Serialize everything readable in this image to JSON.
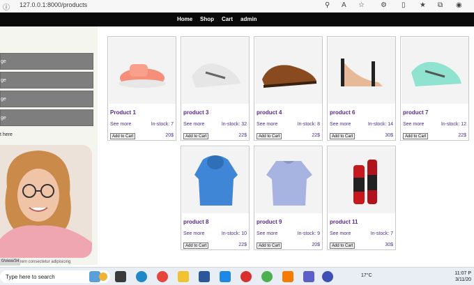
{
  "browser": {
    "url": "127.0.0.1:8000/products"
  },
  "nav": {
    "items": [
      "Home",
      "Shop",
      "Cart",
      "admin"
    ]
  },
  "sidebar": {
    "buttons": [
      "ge",
      "ge",
      "ge",
      "ge"
    ],
    "text": "t here",
    "footer": "Lorem consectetur adipisicing",
    "tooltip": "0/view/34"
  },
  "products": [
    {
      "name": "Product 1",
      "see": "See more",
      "stock": "In-stock: 7",
      "add": "Add to Cart",
      "price": "20$",
      "icon": "pink-baby-shoe-image"
    },
    {
      "name": "product 3",
      "see": "See more",
      "stock": "In-stock: 32",
      "add": "Add to Cart",
      "price": "22$",
      "icon": "white-golf-shoe-image"
    },
    {
      "name": "product 4",
      "see": "See more",
      "stock": "In-stock: 8",
      "add": "Add to Cart",
      "price": "22$",
      "icon": "brown-leather-shoe-image"
    },
    {
      "name": "product 6",
      "see": "See more",
      "stock": "In-stock: 14",
      "add": "Add to Cart",
      "price": "30$",
      "icon": "high-heel-image"
    },
    {
      "name": "product 7",
      "see": "See more",
      "stock": "In-stock: 12",
      "add": "Add to Cart",
      "price": "22$",
      "icon": "mint-golf-shoe-image"
    },
    {
      "name": "product 8",
      "see": "See more",
      "stock": "In-stock: 10",
      "add": "Add to Cart",
      "price": "22$",
      "icon": "blue-hoodie-image"
    },
    {
      "name": "product 9",
      "see": "See more",
      "stock": "In-stock: 9",
      "add": "Add to Cart",
      "price": "20$",
      "icon": "lavender-sweater-image"
    },
    {
      "name": "product 11",
      "see": "See more",
      "stock": "In-stock: 7",
      "add": "Add to Cart",
      "price": "30$",
      "icon": "red-bottle-image"
    }
  ],
  "taskbar": {
    "search": "Type here to search",
    "weather": "17°C",
    "time": "11:07 P",
    "date": "3/11/20"
  },
  "colors": {
    "navbar": "#0a0a0a",
    "sidebar_button": "#7e7e7e",
    "link": "#4b2d8a"
  }
}
